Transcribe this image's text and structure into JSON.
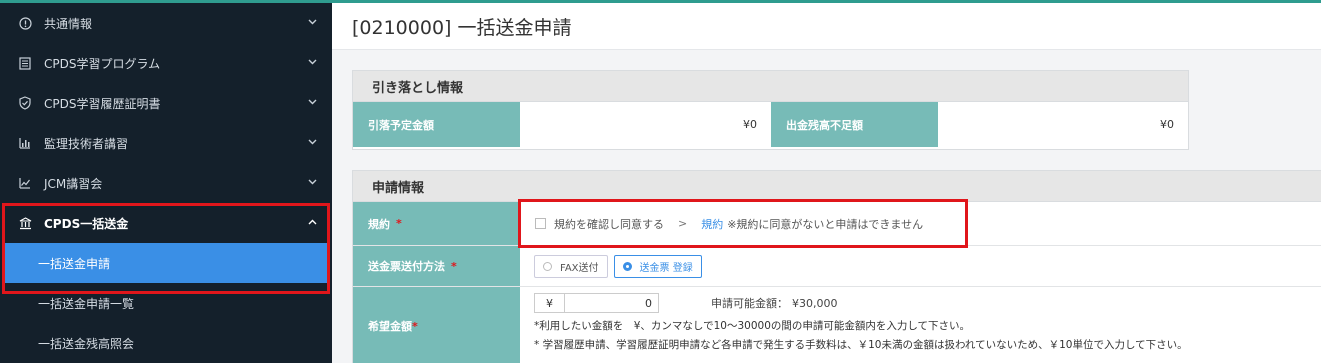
{
  "sidebar": {
    "items": [
      {
        "label": "共通情報",
        "icon": "info-circle-icon",
        "chevron": "chevron-down"
      },
      {
        "label": "CPDS学習プログラム",
        "icon": "document-list-icon",
        "chevron": "chevron-down"
      },
      {
        "label": "CPDS学習履歴証明書",
        "icon": "shield-check-icon",
        "chevron": "chevron-down"
      },
      {
        "label": "監理技術者講習",
        "icon": "bar-chart-icon",
        "chevron": "chevron-down"
      },
      {
        "label": "JCM講習会",
        "icon": "line-chart-icon",
        "chevron": "chevron-down"
      },
      {
        "label": "CPDS一括送金",
        "icon": "bank-icon",
        "chevron": "chevron-up"
      }
    ],
    "sub_items": [
      {
        "label": "一括送金申請"
      },
      {
        "label": "一括送金申請一覧"
      },
      {
        "label": "一括送金残高照会"
      }
    ]
  },
  "page": {
    "title": "[0210000] 一括送金申請"
  },
  "withdrawal": {
    "heading": "引き落とし情報",
    "scheduled_label": "引落予定金額",
    "scheduled_value": "¥0",
    "shortage_label": "出金残高不足額",
    "shortage_value": "¥0"
  },
  "application": {
    "heading": "申請情報",
    "terms_label": "規約",
    "required_mark": "*",
    "terms_checkbox_text": "規約を確認し同意する",
    "terms_arrow": ">",
    "terms_link": "規約",
    "terms_note": "※規約に同意がないと申請はできません",
    "method_label": "送金票送付方法",
    "method_options": [
      "FAX送付",
      "送金票 登録"
    ],
    "amount_label": "希望金額",
    "amount_prefix": "¥",
    "amount_value": "0",
    "available_label": "申請可能金額：",
    "available_value": "¥30,000",
    "note1": "*利用したい金額を　¥、カンマなしで10～30000の間の申請可能金額内を入力して下さい。",
    "note2": "* 学習履歴申請、学習履歴証明申請など各申請で発生する手数料は、￥10未満の金額は扱われていないため、￥10単位で入力して下さい。"
  },
  "colors": {
    "sidebar_bg": "#14202b",
    "active_blue": "#3a8fe6",
    "label_teal": "#77bbb7",
    "highlight_red": "#e0161b",
    "top_accent": "#2f9c8f"
  }
}
